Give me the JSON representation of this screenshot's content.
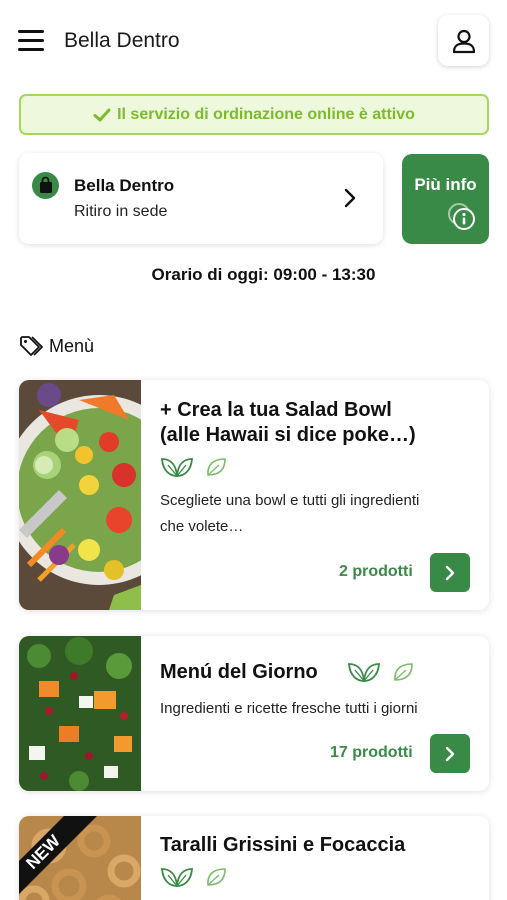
{
  "header": {
    "title": "Bella Dentro",
    "menu_icon": "hamburger-icon",
    "user_icon": "user-icon"
  },
  "status": {
    "text": "Il servizio di ordinazione online è attivo",
    "icon": "check-icon",
    "color": "#7cbc2b"
  },
  "store": {
    "name": "Bella Dentro",
    "mode": "Ritiro in sede",
    "icon": "shopping-bag-icon",
    "chevron_icon": "chevron-right-icon"
  },
  "info_button": {
    "label": "Più info",
    "icon": "info-icon",
    "color": "#3a8a47"
  },
  "hours": {
    "text": "Orario di oggi: 09:00 - 13:30"
  },
  "menu_section": {
    "title": "Menù",
    "icon": "tag-icon"
  },
  "menu_items": [
    {
      "title_line1": "+ Crea la tua Salad Bowl",
      "title_line2": "(alle Hawaii si dice poke…)",
      "description_line1": "Scegliete una bowl e tutti gli ingredienti",
      "description_line2": "che volete…",
      "count": "2 prodotti",
      "icons": [
        "vegan-icon",
        "vegetarian-icon"
      ]
    },
    {
      "title": "Menú del Giorno",
      "description": "Ingredienti e ricette fresche tutti i giorni",
      "count": "17 prodotti",
      "icons": [
        "vegan-icon",
        "vegetarian-icon"
      ]
    },
    {
      "title": "Taralli Grissini e Focaccia",
      "badge": "NEW",
      "icons": [
        "vegan-icon",
        "vegetarian-icon"
      ]
    }
  ],
  "colors": {
    "accent": "#3a8a47",
    "banner_bg": "#eef8dc",
    "banner_border": "#a6d65a"
  }
}
